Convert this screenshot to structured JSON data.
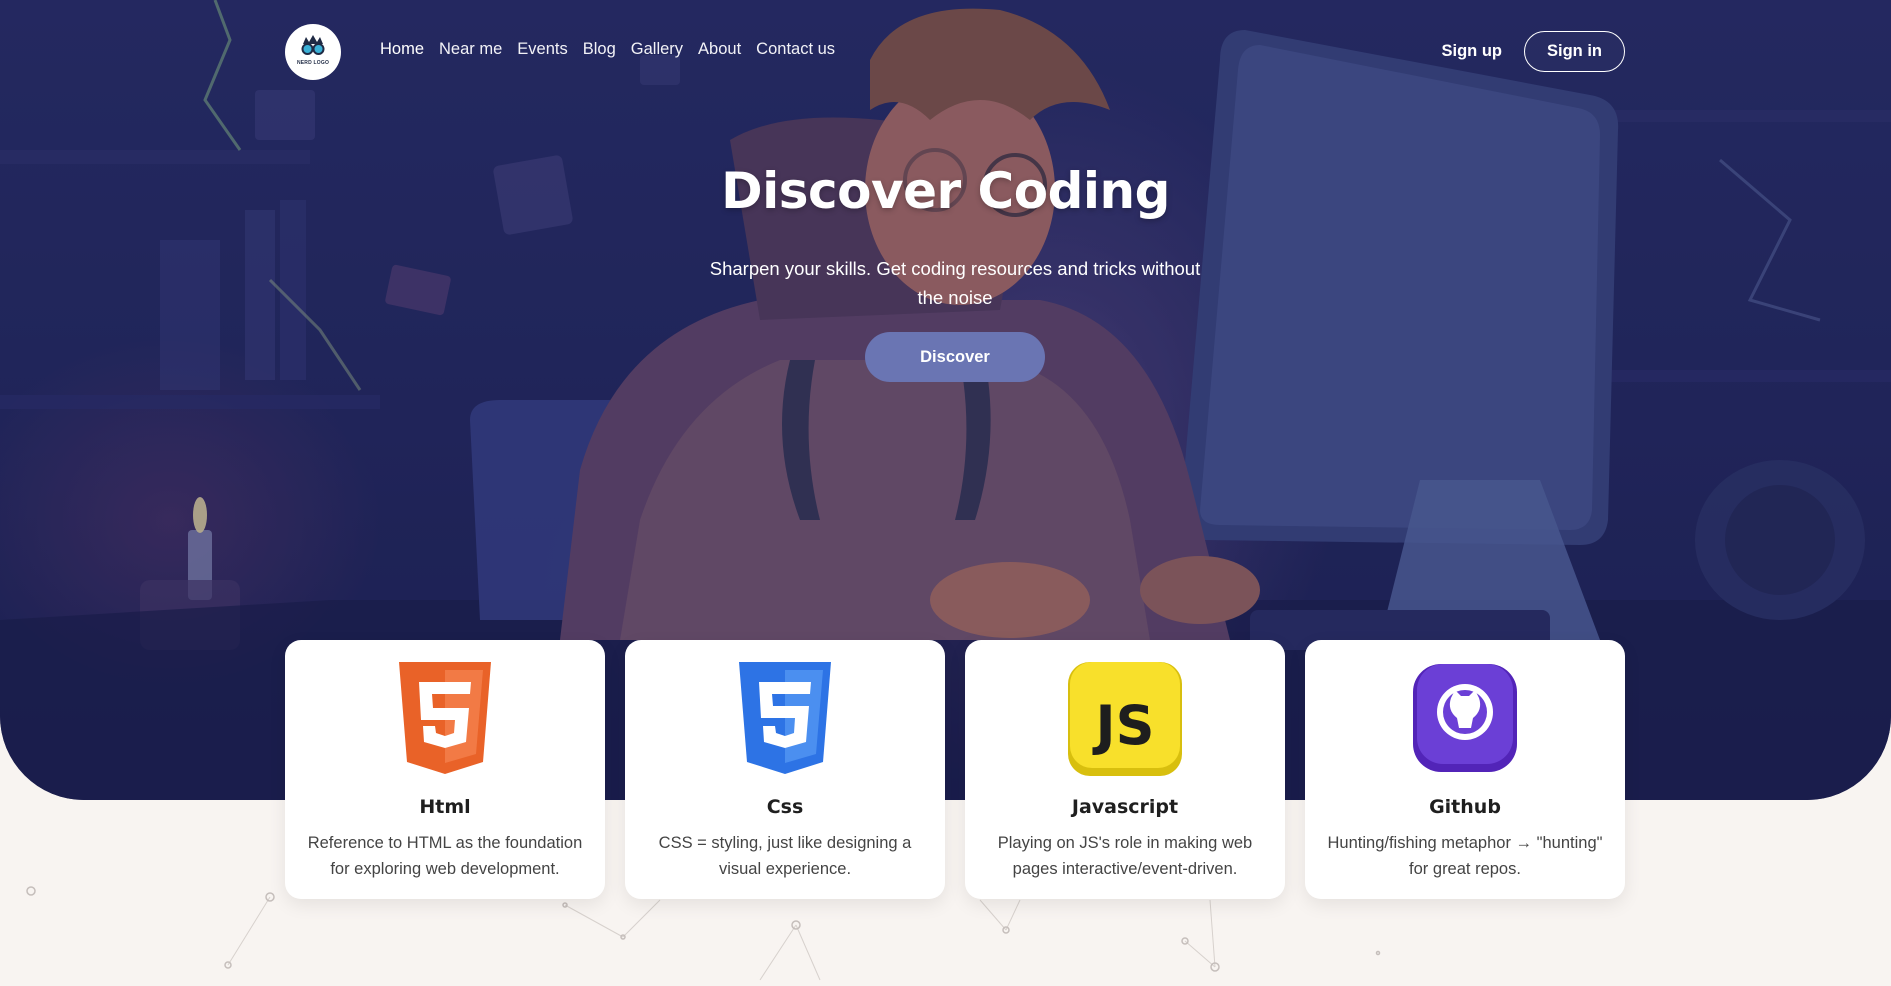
{
  "brand": {
    "logo_text": "NERD LOGO"
  },
  "nav": {
    "items": [
      {
        "label": "Home",
        "active": true
      },
      {
        "label": "Near me"
      },
      {
        "label": "Events"
      },
      {
        "label": "Blog"
      },
      {
        "label": "Gallery"
      },
      {
        "label": "About"
      },
      {
        "label": "Contact us"
      }
    ]
  },
  "auth": {
    "signup_label": "Sign up",
    "signin_label": "Sign in"
  },
  "hero": {
    "title": "Discover Coding",
    "subtitle": "Sharpen your skills. Get coding resources and tricks without the noise",
    "cta_label": "Discover",
    "cta_color": "#6a75b3"
  },
  "cards": [
    {
      "icon": "html5-icon",
      "title": "Html",
      "description": "Reference to HTML as the foundation for exploring web development.",
      "color": "#e96228"
    },
    {
      "icon": "css3-icon",
      "title": "Css",
      "description": "CSS = styling, just like designing a visual experience.",
      "color": "#2d73e5"
    },
    {
      "icon": "javascript-icon",
      "title": "Javascript",
      "description": "Playing on JS's role in making web pages interactive/event-driven.",
      "color": "#f7df1e"
    },
    {
      "icon": "github-icon",
      "title": "Github",
      "description": "Hunting/fishing metaphor → \"hunting\" for great repos.",
      "color": "#6b3fd6"
    }
  ]
}
